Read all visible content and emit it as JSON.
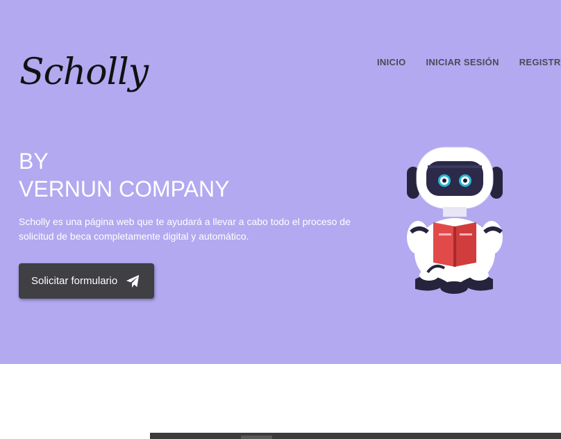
{
  "brand": {
    "logo_text": "Scholly"
  },
  "nav": {
    "items": [
      "INICIO",
      "INICIAR SESIÓN",
      "REGISTRA"
    ]
  },
  "hero": {
    "title_line1": "BY",
    "title_line2": "VERNUN COMPANY",
    "description": "Scholly es una página web que te ayudará a llevar a cabo todo el proceso de solicitud de beca completamente digital y automático.",
    "cta_label": "Solicitar formulario",
    "cta_icon": "paper-plane-icon",
    "illustration": "robot-reading-book"
  },
  "colors": {
    "hero_bg": "#b2a9f1",
    "button_bg": "#3f3f44",
    "nav_text": "#4a4a56",
    "book_red": "#e24a4a"
  }
}
